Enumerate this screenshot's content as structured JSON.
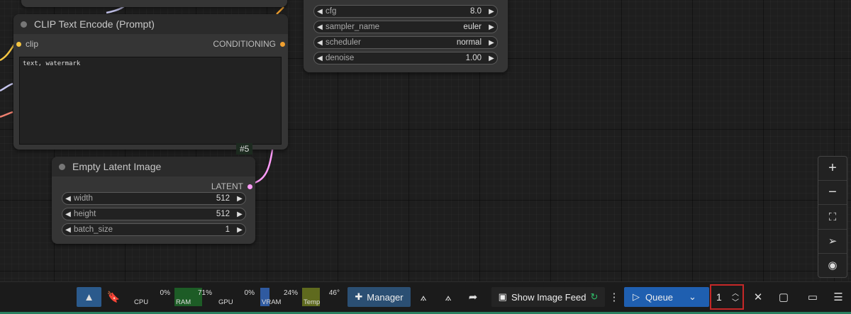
{
  "nodes": {
    "clip_text_encode": {
      "title": "CLIP Text Encode (Prompt)",
      "input": "clip",
      "output": "CONDITIONING",
      "text": "text, watermark",
      "badge": "#5"
    },
    "ksampler_widgets": [
      {
        "label": "cfg",
        "value": "8.0"
      },
      {
        "label": "sampler_name",
        "value": "euler"
      },
      {
        "label": "scheduler",
        "value": "normal"
      },
      {
        "label": "denoise",
        "value": "1.00"
      }
    ],
    "empty_latent": {
      "title": "Empty Latent Image",
      "output": "LATENT",
      "widgets": [
        {
          "label": "width",
          "value": "512"
        },
        {
          "label": "height",
          "value": "512"
        },
        {
          "label": "batch_size",
          "value": "1"
        }
      ]
    }
  },
  "zoom_controls": [
    "zoom-in-icon",
    "zoom-out-icon",
    "fit-view-icon",
    "locate-icon",
    "visibility-icon"
  ],
  "monitor": {
    "cpu": {
      "label": "CPU",
      "pct": "0%"
    },
    "ram": {
      "label": "RAM",
      "pct": "71%"
    },
    "gpu": {
      "label": "GPU",
      "pct": "0%"
    },
    "vram": {
      "label": "VRAM",
      "pct": "24%"
    },
    "temp": {
      "label": "Temp",
      "value": "46°"
    }
  },
  "toolbar": {
    "manager_label": "Manager",
    "show_image_feed_label": "Show Image Feed",
    "queue_label": "Queue",
    "batch_count": "1"
  },
  "colors": {
    "accent_blue": "#1f5fb0",
    "manager_bg": "#2b4f73",
    "clip_pin": "#f5c542",
    "conditioning_pin": "#f0a030",
    "latent_pin": "#ff9cf9",
    "highlight_border": "#c62828"
  }
}
